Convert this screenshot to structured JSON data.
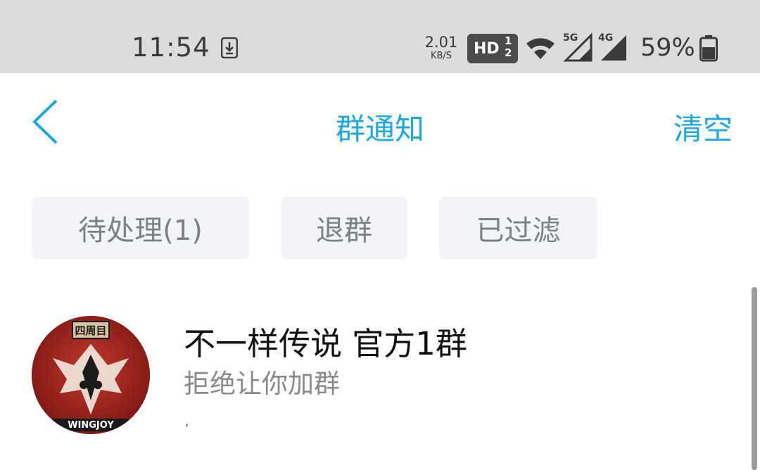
{
  "status_bar": {
    "time": "11:54",
    "speed_value": "2.01",
    "speed_unit": "KB/S",
    "hd_label": "HD",
    "hd_num_top": "1",
    "hd_num_bottom": "2",
    "net_5g": "5G",
    "net_4g": "4G",
    "battery": "59%",
    "icons": [
      "download-notification-icon",
      "wifi-icon",
      "cell-signal-icon",
      "battery-icon"
    ]
  },
  "header": {
    "back_icon": "chevron-left-icon",
    "title": "群通知",
    "clear_label": "清空"
  },
  "tabs": [
    {
      "label": "待处理(1)"
    },
    {
      "label": "退群"
    },
    {
      "label": "已过滤"
    }
  ],
  "notifications": [
    {
      "group_name": "不一样传说 官方1群",
      "status": "拒绝让你加群",
      "extra": ".",
      "avatar_text_top": "四周目",
      "avatar_text_bottom": "WINGJOY"
    }
  ],
  "colors": {
    "accent": "#1ea7e1",
    "status_bar_bg": "#dcdcdc",
    "tab_bg": "#f2f4f7",
    "avatar_bg": "#9b1e1a"
  }
}
